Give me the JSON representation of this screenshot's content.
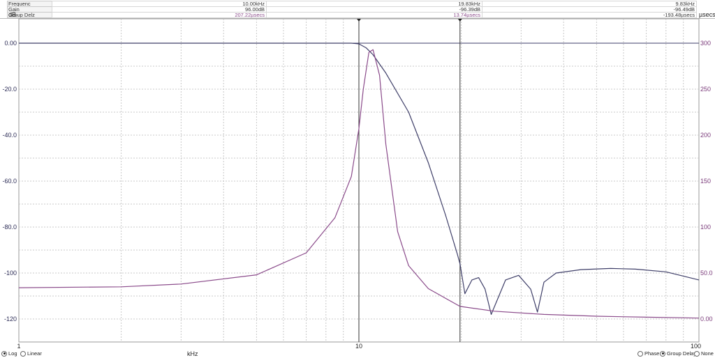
{
  "readout": {
    "rows": [
      {
        "name": "Frequenc",
        "v1": "10.00kHz",
        "v2": "19.83kHz",
        "v3": "9.83kHz"
      },
      {
        "name": "Gain",
        "v1": "96.00dB",
        "v2": "-96.39dB",
        "v3": "-96.49dB"
      },
      {
        "name": "Group Delz",
        "v1": "207.22µsecs",
        "v2": "13.74µsecs",
        "v3": "-193.48µsecs"
      }
    ]
  },
  "axis": {
    "left_unit": "dB",
    "right_unit": "µsecs",
    "x_unit": "kHz",
    "left_ticks": [
      "0.00",
      "-20.0",
      "-40.0",
      "-60.0",
      "-80.0",
      "-100",
      "-120"
    ],
    "right_ticks": [
      "300",
      "250",
      "200",
      "150",
      "100",
      "50.0",
      "0.00"
    ],
    "x_ticks": [
      "1",
      "10",
      "100"
    ]
  },
  "options": {
    "left": [
      {
        "label": "Log",
        "selected": true
      },
      {
        "label": "Linear",
        "selected": false
      }
    ],
    "right": [
      {
        "label": "Phase",
        "selected": false
      },
      {
        "label": "Group Delay",
        "selected": true
      },
      {
        "label": "None",
        "selected": false
      }
    ]
  },
  "colors": {
    "gain": "#3e3e68",
    "delay": "#8a4a8a",
    "grid": "#c8c8c8"
  },
  "chart_data": {
    "type": "line",
    "x_scale": "log",
    "xlim": [
      1,
      100
    ],
    "ylim_left": [
      -120,
      0
    ],
    "ylim_right": [
      0,
      300
    ],
    "xlabel": "kHz",
    "ylabel": "dB",
    "ylabel_right": "µsecs",
    "grid": true,
    "cursors_khz": [
      10.0,
      19.83
    ],
    "series": [
      {
        "axis": "left",
        "x": [
          1,
          2,
          5,
          9.5,
          10,
          10.5,
          11,
          12,
          14,
          16,
          18,
          19.5,
          19.83,
          20.5,
          21.5,
          22.5,
          23.5,
          24.5,
          27,
          29.5,
          32,
          33.5,
          35,
          38,
          45,
          55,
          65,
          80,
          100
        ],
        "y": [
          0,
          0,
          0,
          0,
          -0.3,
          -2,
          -5,
          -13,
          -30,
          -52,
          -75,
          -92,
          -96,
          -109,
          -103,
          -102,
          -107,
          -118,
          -103,
          -101,
          -107,
          -117,
          -104,
          -100,
          -98.5,
          -98,
          -98.3,
          -99.5,
          -103
        ]
      },
      {
        "axis": "right",
        "x": [
          1,
          2,
          3,
          5,
          7,
          8.5,
          9.5,
          10,
          10.3,
          10.7,
          11,
          11.5,
          12,
          13,
          14,
          16,
          19.83,
          25,
          35,
          50,
          70,
          100
        ],
        "y": [
          34,
          35,
          38,
          48,
          72,
          110,
          155,
          207,
          250,
          290,
          293,
          265,
          190,
          95,
          58,
          33,
          13.7,
          8.5,
          5,
          3,
          2,
          1
        ]
      }
    ]
  }
}
